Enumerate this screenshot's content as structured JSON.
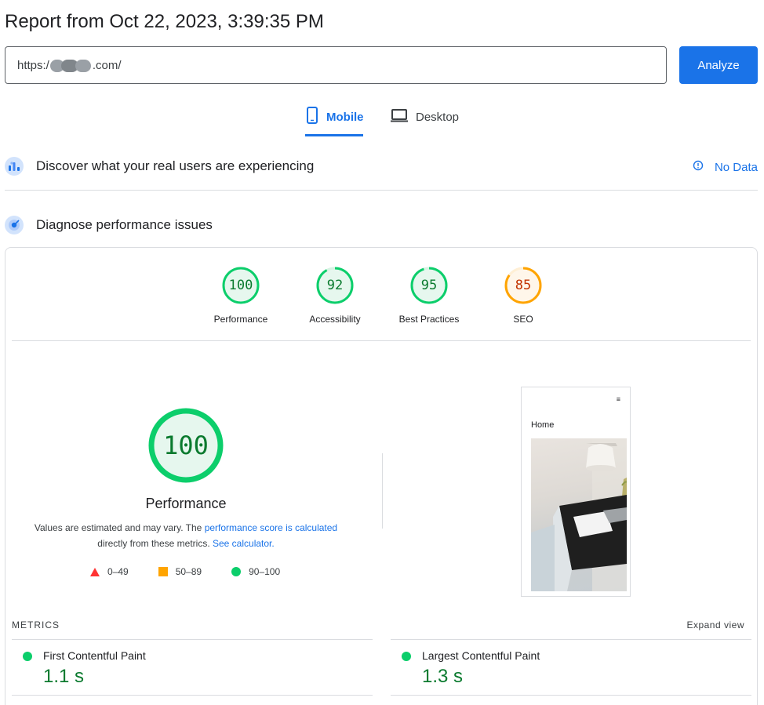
{
  "header": {
    "title": "Report from Oct 22, 2023, 3:39:35 PM"
  },
  "url_input": {
    "prefix": "https:/",
    "suffix": ".com/"
  },
  "analyze_button": {
    "label": "Analyze",
    "color": "#1a73e8"
  },
  "tabs": [
    {
      "label": "Mobile",
      "active": true
    },
    {
      "label": "Desktop",
      "active": false
    }
  ],
  "field_data": {
    "title": "Discover what your real users are experiencing",
    "status_label": "No Data"
  },
  "diagnose": {
    "title": "Diagnose performance issues"
  },
  "category_scores": [
    {
      "label": "Performance",
      "score": "100",
      "color": "#0cce6b"
    },
    {
      "label": "Accessibility",
      "score": "92",
      "color": "#0cce6b"
    },
    {
      "label": "Best Practices",
      "score": "95",
      "color": "#0cce6b"
    },
    {
      "label": "SEO",
      "score": "85",
      "color": "#ffa400"
    }
  ],
  "performance": {
    "score": "100",
    "label": "Performance",
    "desc_text_1": "Values are estimated and may vary. The",
    "desc_link_1": "performance score is calculated",
    "desc_text_2": "directly from these metrics.",
    "desc_link_2": "See calculator."
  },
  "legend": [
    {
      "range": "0–49",
      "shape": "triangle",
      "color": "#ff3333"
    },
    {
      "range": "50–89",
      "shape": "square",
      "color": "#ffa400"
    },
    {
      "range": "90–100",
      "shape": "circle",
      "color": "#0cce6b"
    }
  ],
  "screenshot_preview": {
    "page_heading": "Home",
    "menu_icon": "≡"
  },
  "metrics": {
    "heading": "METRICS",
    "expand_label": "Expand view",
    "items": [
      {
        "name": "First Contentful Paint",
        "value": "1.1 s",
        "status": "good"
      },
      {
        "name": "Largest Contentful Paint",
        "value": "1.3 s",
        "status": "good"
      }
    ]
  }
}
